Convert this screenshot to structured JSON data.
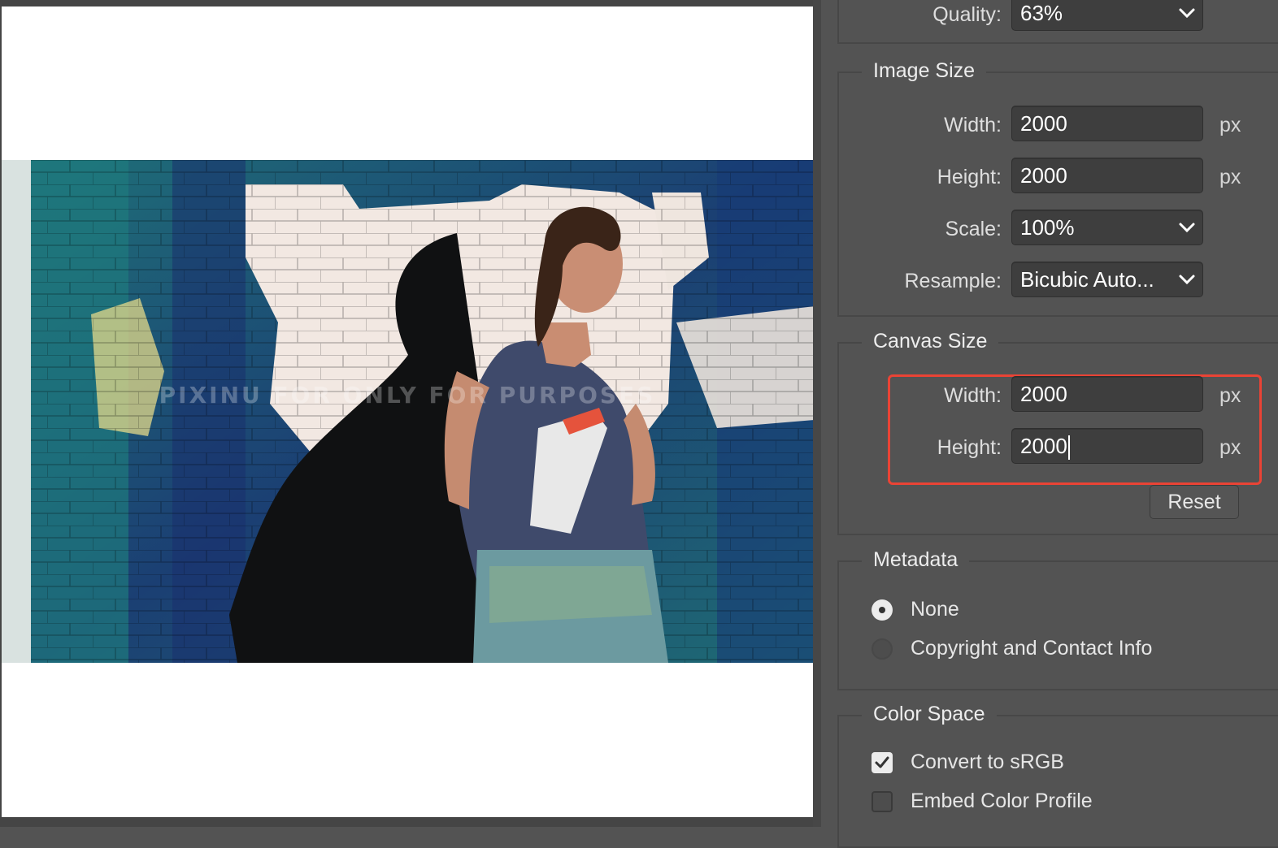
{
  "canvas": {
    "watermark": "PIXINU FOR ONLY FOR PURPOSES"
  },
  "quality": {
    "label": "Quality:",
    "value": "63%"
  },
  "image_size": {
    "title": "Image Size",
    "width_label": "Width:",
    "width_value": "2000",
    "width_unit": "px",
    "height_label": "Height:",
    "height_value": "2000",
    "height_unit": "px",
    "scale_label": "Scale:",
    "scale_value": "100%",
    "resample_label": "Resample:",
    "resample_value": "Bicubic Auto..."
  },
  "canvas_size": {
    "title": "Canvas Size",
    "width_label": "Width:",
    "width_value": "2000",
    "width_unit": "px",
    "height_label": "Height:",
    "height_value": "2000",
    "height_unit": "px",
    "reset_label": "Reset"
  },
  "metadata": {
    "title": "Metadata",
    "options": [
      {
        "label": "None",
        "selected": true
      },
      {
        "label": "Copyright and Contact Info",
        "selected": false
      }
    ]
  },
  "color_space": {
    "title": "Color Space",
    "options": [
      {
        "label": "Convert to sRGB",
        "checked": true
      },
      {
        "label": "Embed Color Profile",
        "checked": false
      }
    ]
  },
  "colors": {
    "panel_bg": "#535353",
    "highlight": "#ea4335",
    "field_bg": "#3e3e3e"
  }
}
